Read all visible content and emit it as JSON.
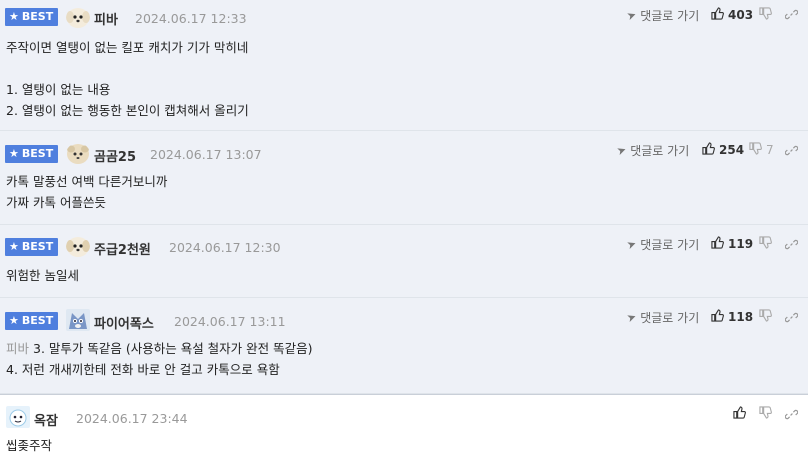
{
  "badge_label": "BEST",
  "reply_label": "댓글로 가기",
  "comments": [
    {
      "best": true,
      "nickname": "피바",
      "date": "2024.06.17 12:33",
      "up": "403",
      "down": "",
      "lines": [
        "주작이면 열탱이 없는 킬포 캐치가 기가 막히네",
        "",
        "1. 열탱이 없는 내용",
        "2. 열탱이 없는 행동한 본인이 캡쳐해서 올리기"
      ]
    },
    {
      "best": true,
      "nickname": "곰곰25",
      "date": "2024.06.17 13:07",
      "up": "254",
      "down": "7",
      "lines": [
        "카톡 말풍선 여백 다른거보니까",
        "가짜 카톡 어플쓴듯"
      ]
    },
    {
      "best": true,
      "nickname": "주급2천원",
      "date": "2024.06.17 12:30",
      "up": "119",
      "down": "",
      "lines": [
        "위험한 놈일세"
      ]
    },
    {
      "best": true,
      "nickname": "파이어폭스",
      "date": "2024.06.17 13:11",
      "up": "118",
      "down": "",
      "quote": "피바",
      "lines": [
        "3. 말투가 똑같음 (사용하는 욕설 철자가 완전 똑같음)",
        "4. 저런 개새끼한테 전화 바로 안 걸고 카톡으로 욕함"
      ]
    },
    {
      "best": false,
      "nickname": "옥잠",
      "date": "2024.06.17 23:44",
      "up": "",
      "down": "",
      "lines": [
        "씹좆주작"
      ]
    }
  ]
}
